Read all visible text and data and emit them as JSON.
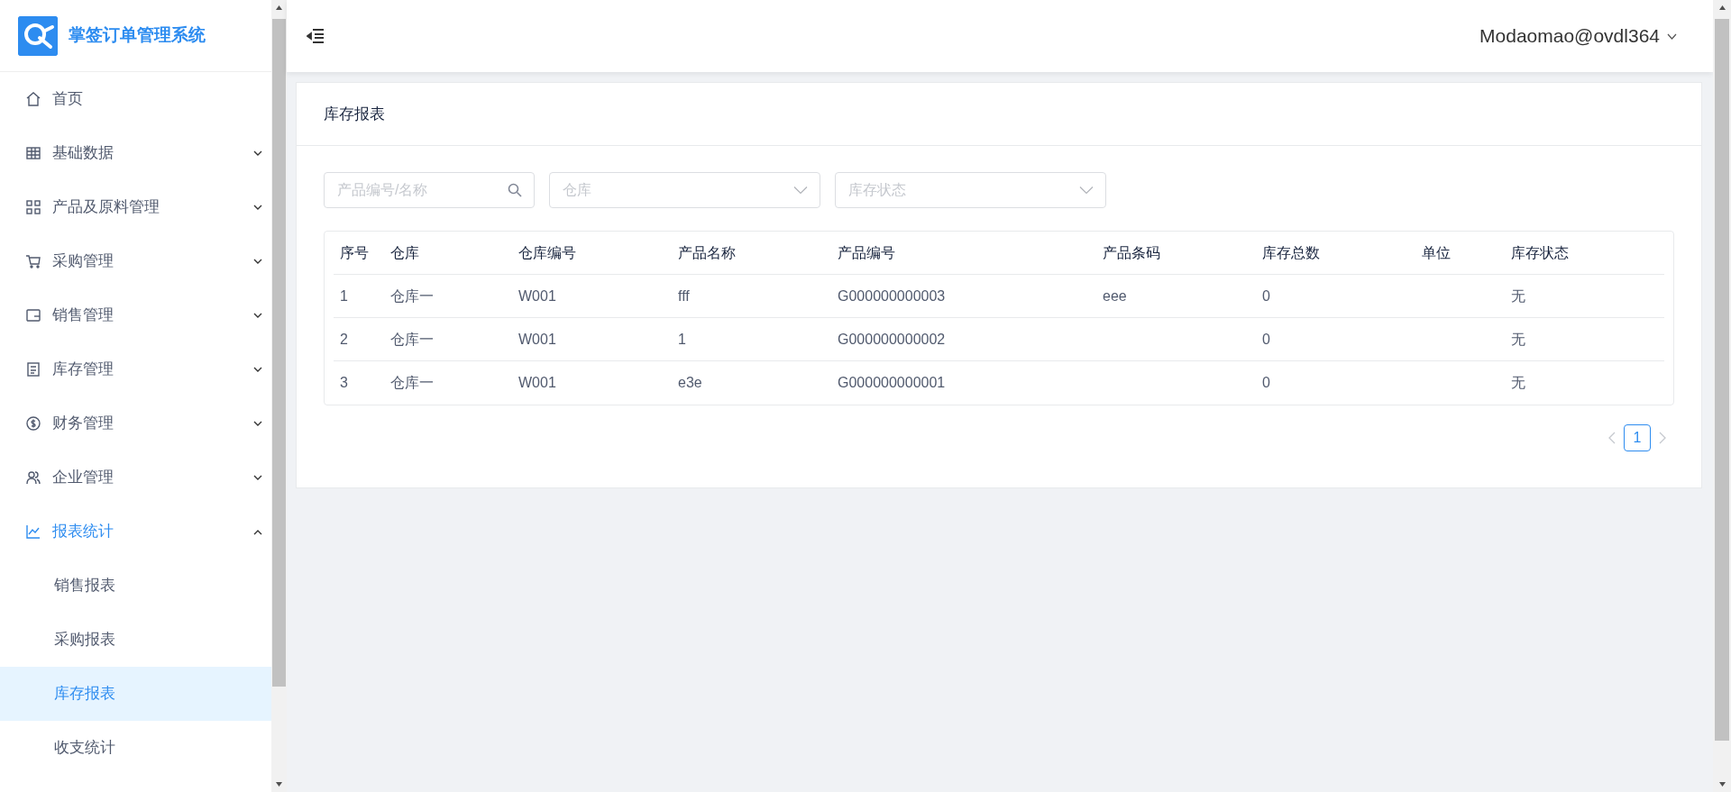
{
  "app": {
    "title": "掌签订单管理系统"
  },
  "sidebar": {
    "items": [
      {
        "label": "首页",
        "selected": false
      },
      {
        "label": "基础数据",
        "selected": false,
        "expanded": false
      },
      {
        "label": "产品及原料管理",
        "selected": false,
        "expanded": false
      },
      {
        "label": "采购管理",
        "selected": false,
        "expanded": false
      },
      {
        "label": "销售管理",
        "selected": false,
        "expanded": false
      },
      {
        "label": "库存管理",
        "selected": false,
        "expanded": false
      },
      {
        "label": "财务管理",
        "selected": false,
        "expanded": false
      },
      {
        "label": "企业管理",
        "selected": false,
        "expanded": false
      },
      {
        "label": "报表统计",
        "selected": true,
        "expanded": true,
        "children": [
          {
            "label": "销售报表",
            "selected": false
          },
          {
            "label": "采购报表",
            "selected": false
          },
          {
            "label": "库存报表",
            "selected": true
          },
          {
            "label": "收支统计",
            "selected": false
          }
        ]
      }
    ]
  },
  "header": {
    "user": "Modaomao@ovdl364"
  },
  "page": {
    "title": "库存报表"
  },
  "filters": {
    "search": {
      "placeholder": "产品编号/名称"
    },
    "warehouse": {
      "placeholder": "仓库"
    },
    "status": {
      "placeholder": "库存状态"
    }
  },
  "table": {
    "columns": [
      "序号",
      "仓库",
      "仓库编号",
      "产品名称",
      "产品编号",
      "产品条码",
      "库存总数",
      "单位",
      "库存状态"
    ],
    "rows": [
      [
        "1",
        "仓库一",
        "W001",
        "fff",
        "G000000000003",
        "eee",
        "0",
        "",
        "无"
      ],
      [
        "2",
        "仓库一",
        "W001",
        "1",
        "G000000000002",
        "",
        "0",
        "",
        "无"
      ],
      [
        "3",
        "仓库一",
        "W001",
        "e3e",
        "G000000000001",
        "",
        "0",
        "",
        "无"
      ]
    ]
  },
  "pagination": {
    "pages": [
      {
        "label": "1",
        "selected": true
      }
    ]
  }
}
